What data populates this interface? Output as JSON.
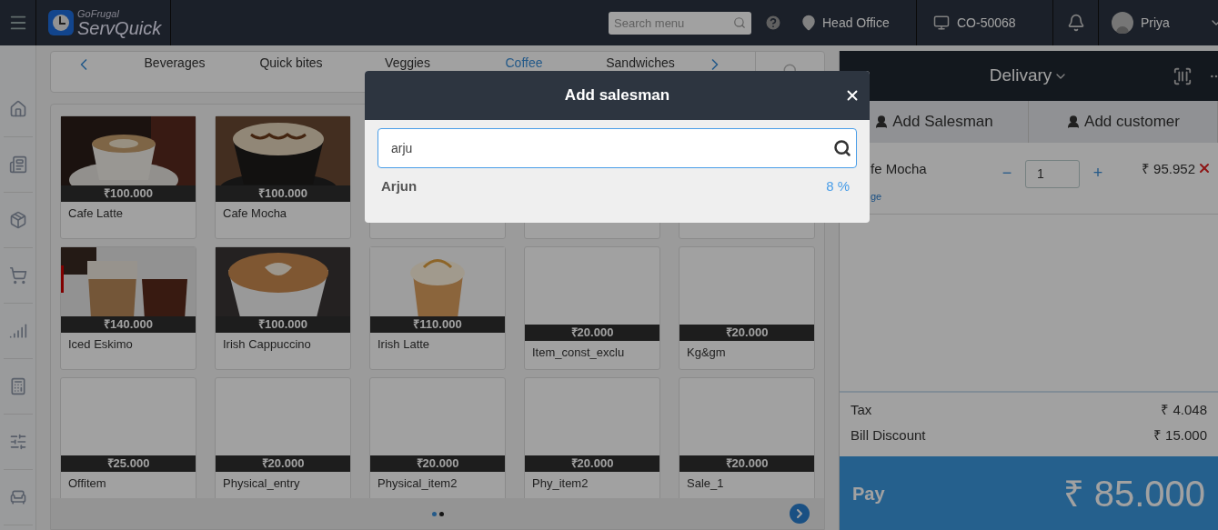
{
  "header": {
    "brand_top": "GoFrugal",
    "brand_name": "ServQuick",
    "search": {
      "placeholder": "Search menu"
    },
    "location": "Head Office",
    "terminal": "CO-50068",
    "user": "Priya"
  },
  "categories": [
    {
      "label": "Beverages",
      "selected": false
    },
    {
      "label": "Quick bites",
      "selected": false
    },
    {
      "label": "Veggies",
      "selected": false
    },
    {
      "label": "Coffee",
      "selected": true
    },
    {
      "label": "Sandwiches",
      "selected": false
    }
  ],
  "products": [
    {
      "name": "Cafe Latte",
      "price": "₹100.000"
    },
    {
      "name": "Cafe Mocha",
      "price": "₹100.000"
    },
    {
      "kind": "covered"
    },
    {
      "kind": "covered"
    },
    {
      "kind": "covered"
    },
    {
      "name": "Iced Eskimo",
      "price": "₹140.000"
    },
    {
      "name": "Irish Cappuccino",
      "price": "₹100.000"
    },
    {
      "name": "Irish Latte",
      "price": "₹110.000"
    },
    {
      "kind": "plain",
      "name": "Item_const_exclu",
      "price": "₹20.000"
    },
    {
      "kind": "plain",
      "name": "Kg&gm",
      "price": "₹20.000"
    },
    {
      "kind": "plain",
      "name": "Offitem",
      "price": "₹25.000"
    },
    {
      "kind": "plain",
      "name": "Physical_entry",
      "price": "₹20.000"
    },
    {
      "kind": "plain",
      "name": "Physical_item2",
      "price": "₹20.000"
    },
    {
      "kind": "plain",
      "name": "Phy_item2",
      "price": "₹20.000"
    },
    {
      "kind": "plain",
      "name": "Sale_1",
      "price": "₹20.000"
    }
  ],
  "pages": [
    {
      "selected": true
    },
    {
      "selected": false
    }
  ],
  "cart": {
    "order_type": "Delivary",
    "tabs": [
      "Add Salesman",
      "Add customer"
    ],
    "items": [
      {
        "name": "fe Mocha",
        "link": "ge",
        "qty": "1",
        "decrease": "−",
        "increase": "+",
        "amount": "₹ 95.952"
      }
    ],
    "totals": [
      {
        "label": "Tax",
        "value": "₹ 4.048"
      },
      {
        "label": "Bill Discount",
        "value": "₹ 15.000"
      }
    ],
    "pay": {
      "label": "Pay",
      "amount": "₹ 85.000"
    }
  },
  "modal": {
    "title": "Add salesman",
    "search": {
      "value": "arju"
    },
    "results": [
      {
        "name": "Arjun",
        "percent": "8 %"
      }
    ]
  }
}
